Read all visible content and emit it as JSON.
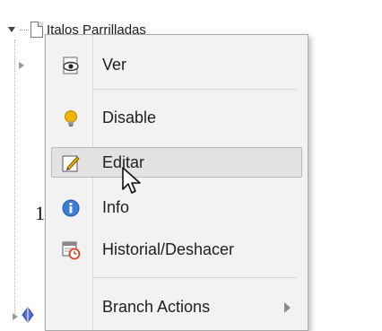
{
  "tree": {
    "root_label": "Italos Parrilladas",
    "left_glyph": "1"
  },
  "context_menu": {
    "items": [
      {
        "label": "Ver",
        "icon": "view-eye-icon",
        "active": false
      },
      {
        "label": "Disable",
        "icon": "lightbulb-icon",
        "active": false
      },
      {
        "label": "Editar",
        "icon": "edit-pencil-icon",
        "active": true
      },
      {
        "label": "Info",
        "icon": "info-icon",
        "active": false
      },
      {
        "label": "Historial/Deshacer",
        "icon": "history-calendar-icon",
        "active": false
      },
      {
        "label": "Branch Actions",
        "icon": "",
        "active": false,
        "has_submenu": true
      }
    ]
  },
  "colors": {
    "menu_background": "#f2f2f2",
    "menu_border": "#a9a9a9",
    "active_item_background": "#e2e2e2",
    "info_icon_blue": "#3a7fd5",
    "history_icon_red": "#d9412b",
    "lightbulb_yellow": "#f0b400"
  }
}
